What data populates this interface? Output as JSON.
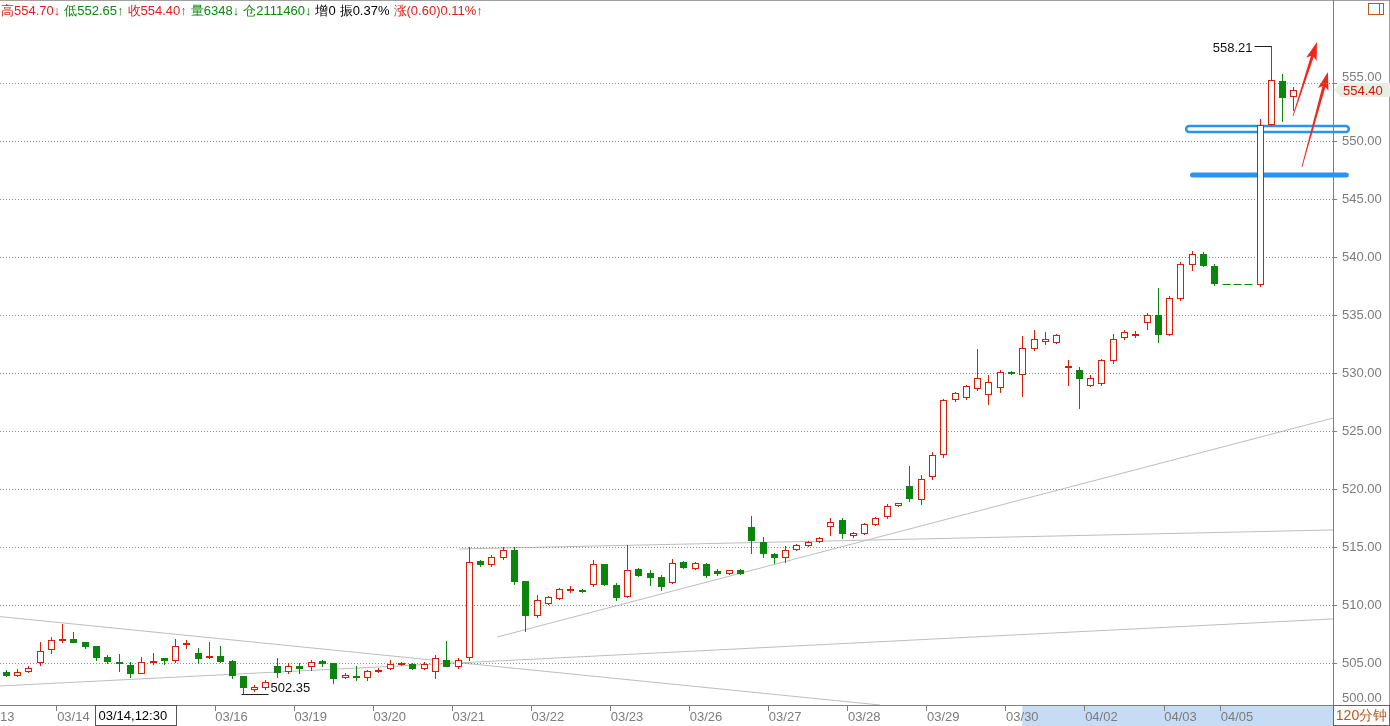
{
  "quote_bar": {
    "items": [
      {
        "text": "高554.70↓",
        "color": "#e0201c"
      },
      {
        "text": "低552.65↑",
        "color": "#0a8a0a"
      },
      {
        "text": "收554.40↑",
        "color": "#e0201c"
      },
      {
        "text": "量6348↓",
        "color": "#0a8a0a"
      },
      {
        "text": "仓2111460↓",
        "color": "#0a8a0a"
      },
      {
        "text": "增0",
        "color": "#000000"
      },
      {
        "text": "振0.37%",
        "color": "#000000"
      },
      {
        "text": "涨(0.60)0.11%↑",
        "color": "#e0201c"
      }
    ]
  },
  "chart": {
    "chart_data": {
      "type": "candlestick",
      "grid": true,
      "ylim": [
        501.38,
        562.16
      ],
      "yticks": [
        {
          "value": 505,
          "label": "505.00"
        },
        {
          "value": 510,
          "label": "510.00"
        },
        {
          "value": 515,
          "label": "515.00"
        },
        {
          "value": 520,
          "label": "520.00"
        },
        {
          "value": 525,
          "label": "525.00"
        },
        {
          "value": 530,
          "label": "530.00"
        },
        {
          "value": 535,
          "label": "535.00"
        },
        {
          "value": 540,
          "label": "540.00"
        },
        {
          "value": 545,
          "label": "545.00"
        },
        {
          "value": 550,
          "label": "550.00"
        },
        {
          "value": 555,
          "label": "555.00"
        }
      ],
      "categories": [
        "13",
        null,
        null,
        null,
        null,
        null,
        "03/14",
        null,
        null,
        null,
        null,
        null,
        null,
        null,
        null,
        null,
        null,
        null,
        null,
        null,
        "03/16",
        null,
        null,
        null,
        null,
        null,
        null,
        "03/19",
        null,
        null,
        null,
        null,
        null,
        null,
        "03/20",
        null,
        null,
        null,
        null,
        null,
        null,
        "03/21",
        null,
        null,
        null,
        null,
        null,
        null,
        "03/22",
        null,
        null,
        null,
        null,
        null,
        null,
        "03/23",
        null,
        null,
        null,
        null,
        null,
        null,
        "03/26",
        null,
        null,
        null,
        null,
        null,
        null,
        "03/27",
        null,
        null,
        null,
        null,
        null,
        null,
        "03/28",
        null,
        null,
        null,
        null,
        null,
        null,
        "03/29",
        null,
        null,
        null,
        null,
        null,
        null,
        "03/30",
        null,
        null,
        null,
        null,
        null,
        null,
        "04/02",
        null,
        null,
        null,
        null,
        null,
        null,
        "04/03",
        null,
        null,
        null,
        null,
        "04/05",
        null,
        null,
        null,
        null,
        null,
        null,
        null,
        null
      ],
      "ohlc": [
        [
          504.2,
          504.4,
          503.9,
          504.0
        ],
        [
          504.0,
          504.5,
          503.9,
          504.2
        ],
        [
          504.3,
          504.7,
          504.2,
          504.6
        ],
        [
          505.1,
          506.8,
          504.8,
          506.0
        ],
        [
          506.2,
          507.2,
          505.9,
          507.0
        ],
        [
          507.0,
          508.4,
          506.8,
          507.1
        ],
        [
          507.1,
          507.7,
          506.8,
          506.8
        ],
        [
          506.8,
          506.8,
          506.3,
          506.5
        ],
        [
          506.5,
          506.5,
          505.3,
          505.5
        ],
        [
          505.5,
          505.7,
          505.0,
          505.2
        ],
        [
          505.1,
          505.8,
          504.3,
          505.0
        ],
        [
          504.8,
          505.1,
          503.8,
          504.1
        ],
        [
          504.1,
          505.5,
          504.1,
          505.1
        ],
        [
          505.1,
          505.9,
          504.9,
          505.2
        ],
        [
          505.4,
          505.4,
          504.9,
          505.3
        ],
        [
          505.3,
          507.1,
          505.1,
          506.5
        ],
        [
          506.6,
          507.0,
          506.3,
          506.7
        ],
        [
          505.9,
          506.3,
          505.0,
          505.4
        ],
        [
          505.5,
          506.8,
          505.4,
          505.6
        ],
        [
          505.6,
          506.5,
          505.1,
          505.2
        ],
        [
          505.2,
          505.3,
          503.7,
          504.0
        ],
        [
          503.9,
          503.9,
          502.35,
          502.9
        ],
        [
          502.8,
          503.1,
          502.6,
          502.9
        ],
        [
          502.9,
          503.5,
          502.8,
          503.4
        ],
        [
          504.7,
          505.4,
          503.8,
          504.2
        ],
        [
          504.3,
          505.0,
          504.1,
          504.7
        ],
        [
          504.7,
          505.0,
          504.1,
          504.6
        ],
        [
          504.7,
          505.3,
          504.4,
          505.1
        ],
        [
          505.2,
          505.3,
          504.7,
          505.0
        ],
        [
          505.0,
          505.0,
          503.3,
          503.7
        ],
        [
          503.8,
          504.1,
          503.7,
          504.0
        ],
        [
          503.9,
          504.7,
          503.5,
          503.8
        ],
        [
          503.8,
          504.4,
          503.5,
          504.3
        ],
        [
          504.3,
          504.6,
          504.2,
          504.4
        ],
        [
          504.6,
          505.3,
          504.5,
          504.9
        ],
        [
          504.9,
          505.1,
          504.8,
          505.0
        ],
        [
          504.9,
          505.0,
          504.5,
          504.6
        ],
        [
          504.6,
          505.1,
          504.5,
          504.9
        ],
        [
          504.3,
          505.7,
          503.7,
          505.4
        ],
        [
          505.3,
          506.9,
          504.7,
          504.7
        ],
        [
          504.7,
          505.4,
          504.6,
          505.3
        ],
        [
          505.5,
          515.0,
          505.3,
          513.7
        ],
        [
          513.8,
          513.9,
          513.4,
          513.5
        ],
        [
          513.5,
          514.3,
          513.4,
          514.1
        ],
        [
          514.1,
          515.0,
          514.0,
          514.7
        ],
        [
          514.7,
          515.0,
          511.8,
          512.1
        ],
        [
          512.1,
          512.1,
          507.8,
          509.1
        ],
        [
          509.1,
          510.9,
          509.0,
          510.4
        ],
        [
          510.2,
          510.8,
          510.1,
          510.7
        ],
        [
          510.6,
          511.5,
          510.5,
          511.4
        ],
        [
          511.3,
          511.6,
          511.1,
          511.4
        ],
        [
          511.3,
          511.4,
          511.1,
          511.2
        ],
        [
          511.8,
          513.9,
          511.6,
          513.5
        ],
        [
          513.5,
          513.5,
          511.7,
          511.8
        ],
        [
          511.7,
          511.9,
          510.4,
          510.7
        ],
        [
          510.8,
          515.2,
          510.7,
          513.0
        ],
        [
          513.1,
          513.2,
          512.5,
          512.6
        ],
        [
          512.8,
          513.0,
          511.7,
          512.4
        ],
        [
          512.4,
          512.6,
          511.3,
          511.6
        ],
        [
          512.0,
          514.0,
          511.9,
          513.6
        ],
        [
          513.7,
          513.8,
          513.2,
          513.3
        ],
        [
          513.2,
          513.7,
          513.1,
          513.6
        ],
        [
          513.5,
          513.6,
          512.4,
          512.6
        ],
        [
          512.9,
          513.1,
          512.6,
          512.8
        ],
        [
          512.8,
          513.0,
          512.7,
          513.0
        ],
        [
          513.0,
          513.1,
          512.7,
          512.8
        ],
        [
          516.7,
          517.7,
          514.5,
          515.6
        ],
        [
          515.4,
          515.9,
          514.1,
          514.5
        ],
        [
          514.4,
          514.5,
          513.6,
          514.1
        ],
        [
          514.1,
          515.1,
          513.7,
          514.7
        ],
        [
          514.8,
          515.3,
          514.7,
          515.2
        ],
        [
          515.2,
          515.5,
          515.1,
          515.4
        ],
        [
          515.5,
          515.9,
          515.4,
          515.8
        ],
        [
          516.8,
          517.5,
          516.0,
          517.2
        ],
        [
          517.3,
          517.5,
          515.8,
          516.2
        ],
        [
          516.0,
          516.3,
          515.9,
          516.2
        ],
        [
          516.2,
          517.1,
          516.1,
          517.0
        ],
        [
          517.0,
          517.6,
          516.9,
          517.5
        ],
        [
          517.7,
          518.7,
          517.5,
          518.5
        ],
        [
          518.6,
          518.8,
          518.5,
          518.8
        ],
        [
          520.3,
          522.0,
          519.0,
          519.2
        ],
        [
          519.1,
          521.2,
          518.7,
          520.9
        ],
        [
          521.1,
          523.2,
          520.9,
          522.9
        ],
        [
          523.0,
          527.8,
          522.8,
          527.7
        ],
        [
          527.8,
          528.4,
          527.6,
          528.3
        ],
        [
          527.9,
          529.0,
          527.8,
          528.9
        ],
        [
          528.7,
          532.1,
          528.5,
          529.6
        ],
        [
          528.2,
          529.8,
          527.3,
          529.2
        ],
        [
          528.8,
          530.3,
          528.4,
          530.1
        ],
        [
          530.1,
          530.2,
          529.9,
          530.0
        ],
        [
          529.9,
          533.2,
          528.0,
          532.2
        ],
        [
          532.2,
          533.7,
          532.0,
          532.9
        ],
        [
          532.8,
          533.5,
          532.5,
          532.9
        ],
        [
          532.7,
          533.4,
          532.6,
          533.3
        ],
        [
          530.5,
          531.1,
          529.0,
          530.6
        ],
        [
          530.3,
          530.5,
          527.0,
          529.6
        ],
        [
          529.0,
          529.8,
          528.9,
          529.6
        ],
        [
          529.1,
          531.2,
          529.0,
          531.1
        ],
        [
          531.1,
          533.4,
          530.9,
          532.9
        ],
        [
          533.1,
          533.7,
          532.9,
          533.5
        ],
        [
          533.3,
          533.6,
          533.1,
          533.4
        ],
        [
          534.4,
          535.2,
          533.8,
          535.0
        ],
        [
          535.0,
          537.3,
          532.7,
          533.4
        ],
        [
          533.4,
          536.6,
          533.3,
          536.5
        ],
        [
          536.5,
          539.6,
          536.3,
          539.4
        ],
        [
          539.4,
          540.5,
          538.9,
          540.3
        ],
        [
          540.3,
          540.4,
          539.2,
          539.3
        ],
        [
          539.2,
          539.4,
          537.6,
          537.8
        ],
        [
          537.7,
          537.7,
          537.7,
          537.7
        ],
        [
          537.7,
          537.7,
          537.7,
          537.7
        ],
        [
          537.7,
          537.7,
          537.7,
          537.7
        ],
        [
          537.7,
          551.9,
          537.5,
          551.4
        ],
        [
          551.5,
          558.21,
          551.4,
          555.3
        ],
        [
          555.2,
          555.8,
          551.7,
          553.8
        ],
        [
          553.9,
          554.7,
          552.65,
          554.4
        ],
        null,
        null,
        null
      ],
      "annotations": [
        "03/14,12:30"
      ]
    },
    "high_label": "558.21",
    "low_label": "502.35",
    "last_price_tag": "554.40",
    "y_axis_bottom_label": "500.00",
    "period": "120分钟"
  }
}
